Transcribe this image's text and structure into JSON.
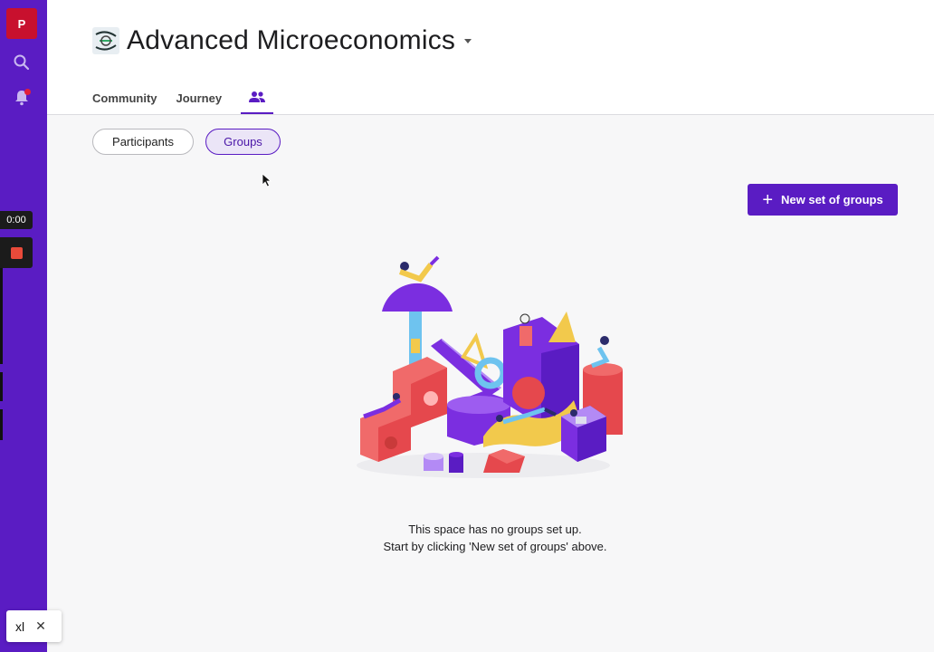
{
  "rail": {
    "logo_letter": "P",
    "icons": [
      "search-icon",
      "bell-icon"
    ]
  },
  "recorder": {
    "timer": "0:00"
  },
  "header": {
    "title": "Advanced Microeconomics",
    "tabs": [
      {
        "label": "Community"
      },
      {
        "label": "Journey"
      }
    ],
    "active_tab_icon": "groups-icon"
  },
  "filters": {
    "participants_label": "Participants",
    "groups_label": "Groups",
    "selected": "Groups"
  },
  "actions": {
    "new_set_label": "New set of groups"
  },
  "empty_state": {
    "line1": "This space has no groups set up.",
    "line2": "Start by clicking 'New set of groups' above."
  },
  "chip": {
    "label": "xl"
  },
  "colors": {
    "rail": "#5a1cc3",
    "accent": "#5a1cc3",
    "logo": "#c8102e",
    "notification": "#e0203a"
  }
}
